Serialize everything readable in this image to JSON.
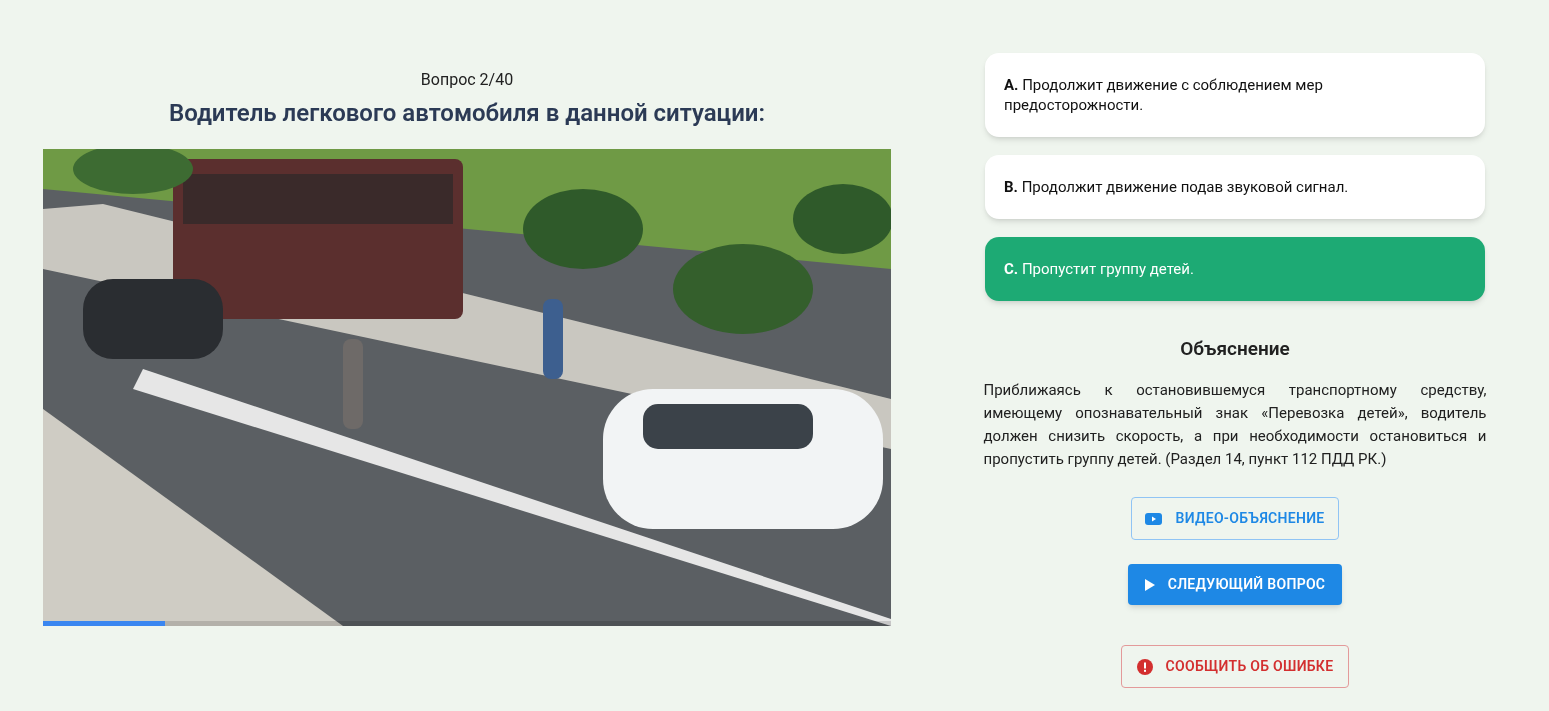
{
  "question": {
    "counter": "Вопрос 2/40",
    "title": "Водитель легкового автомобиля в данной ситуации:"
  },
  "media": {
    "kind": "picture",
    "progress": {
      "level": 0.144
    }
  },
  "answers": [
    {
      "letter": "A.",
      "text": "Продолжит движение с соблюдением мер предосторожности.",
      "selected": false
    },
    {
      "letter": "B.",
      "text": "Продолжит движение подав звуковой сигнал.",
      "selected": false
    },
    {
      "letter": "C.",
      "text": "Пропустит группу детей.",
      "selected": true
    }
  ],
  "explanation": {
    "heading": "Объяснение",
    "text": "Приближаясь к остановившемуся транспортному средству, имеющему опознавательный знак «Перевозка детей», водитель должен снизить скорость, а при необходимости остановиться и пропустить группу детей. (Раздел 14, пункт 112 ПДД РК.)"
  },
  "buttons": [
    {
      "kind": "video",
      "label": "ВИДЕО-ОБЪЯСНЕНИЕ"
    },
    {
      "kind": "next",
      "label": "СЛЕДУЮЩИЙ ВОПРОС"
    },
    {
      "kind": "report",
      "label": "СООБЩИТЬ ОБ ОШИБКЕ"
    }
  ]
}
